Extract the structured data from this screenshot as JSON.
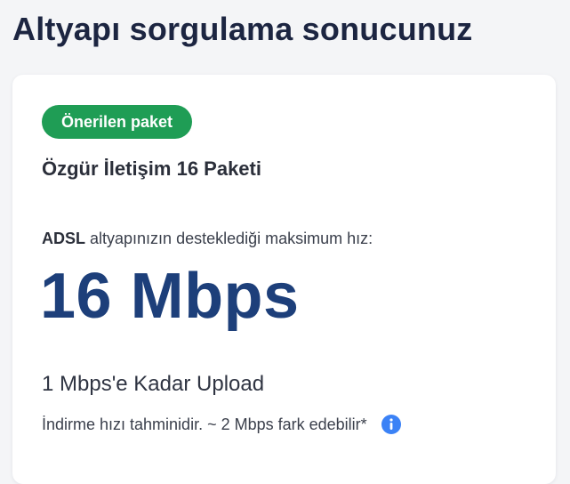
{
  "header": {
    "title": "Altyapı sorgulama sonucunuz"
  },
  "result_card": {
    "badge": "Önerilen paket",
    "package_name": "Özgür İletişim 16 Paketi",
    "infrastructure_type": "ADSL",
    "speed_caption": "altyapınızın desteklediği maksimum hız:",
    "max_speed": "16 Mbps",
    "upload_info": "1 Mbps'e Kadar Upload",
    "download_note": "İndirme hızı tahminidir. ~ 2 Mbps fark edebilir*",
    "info_icon": "info-icon"
  },
  "colors": {
    "badge_bg": "#1f9d55",
    "speed_text": "#1d3f7a",
    "info_icon": "#3b82f6",
    "title_text": "#1c2541"
  }
}
